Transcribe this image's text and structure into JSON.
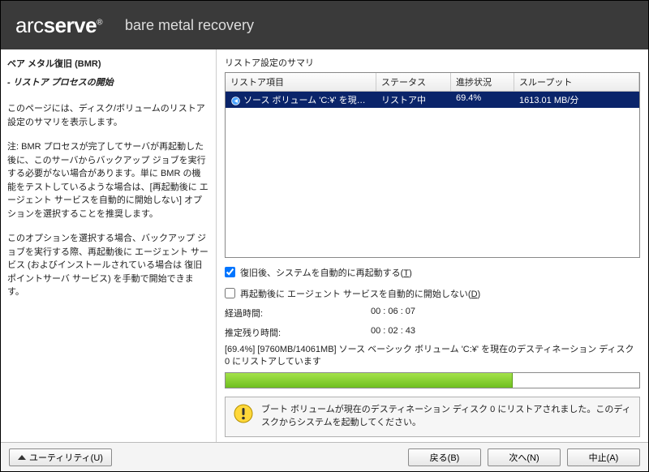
{
  "header": {
    "brand_light": "arc",
    "brand_bold": "serve",
    "subtitle": "bare metal recovery"
  },
  "left": {
    "title": "ベア メタル復旧 (BMR)",
    "subtitle": "- リストア プロセスの開始",
    "para1": "このページには、ディスク/ボリュームのリストア設定のサマリを表示します。",
    "para2": "注: BMR プロセスが完了してサーバが再起動した後に、このサーバからバックアップ ジョブを実行する必要がない場合があります。単に BMR の機能をテストしているような場合は、[再起動後に エージェント サービスを自動的に開始しない] オプションを選択することを推奨します。",
    "para3": "このオプションを選択する場合、バックアップ ジョブを実行する際、再起動後に エージェント サービス (およびインストールされている場合は 復旧ポイントサーバ サービス) を手動で開始できます。"
  },
  "right": {
    "summary_label": "リストア設定のサマリ",
    "columns": {
      "item": "リストア項目",
      "status": "ステータス",
      "progress": "進捗状況",
      "throughput": "スループット"
    },
    "row": {
      "item": "ソース ボリューム 'C:¥' を現在のデスティネ...",
      "status": "リストア中",
      "progress": "69.4%",
      "throughput": "1613.01 MB/分"
    },
    "cb1": {
      "checked": true,
      "label": "復旧後、システムを自動的に再起動する(",
      "u": "T",
      "after": ")"
    },
    "cb2": {
      "checked": false,
      "label": "再起動後に エージェント サービスを自動的に開始しない(",
      "u": "D",
      "after": ")"
    },
    "elapsed_label": "経過時間:",
    "elapsed_value": "00 : 06 : 07",
    "remain_label": "推定残り時間:",
    "remain_value": "00 : 02 : 43",
    "status_line": "[69.4%] [9760MB/14061MB] ソース ベーシック ボリューム 'C:¥' を現在のデスティネーション ディスク 0 にリストアしています",
    "progress_pct": 69.4,
    "notice": "ブート ボリュームが現在のデスティネーション ディスク 0 にリストアされました。このディスクからシステムを起動してください。"
  },
  "footer": {
    "utility": "ユーティリティ(U)",
    "back": "戻る(B)",
    "next": "次へ(N)",
    "abort": "中止(A)"
  }
}
